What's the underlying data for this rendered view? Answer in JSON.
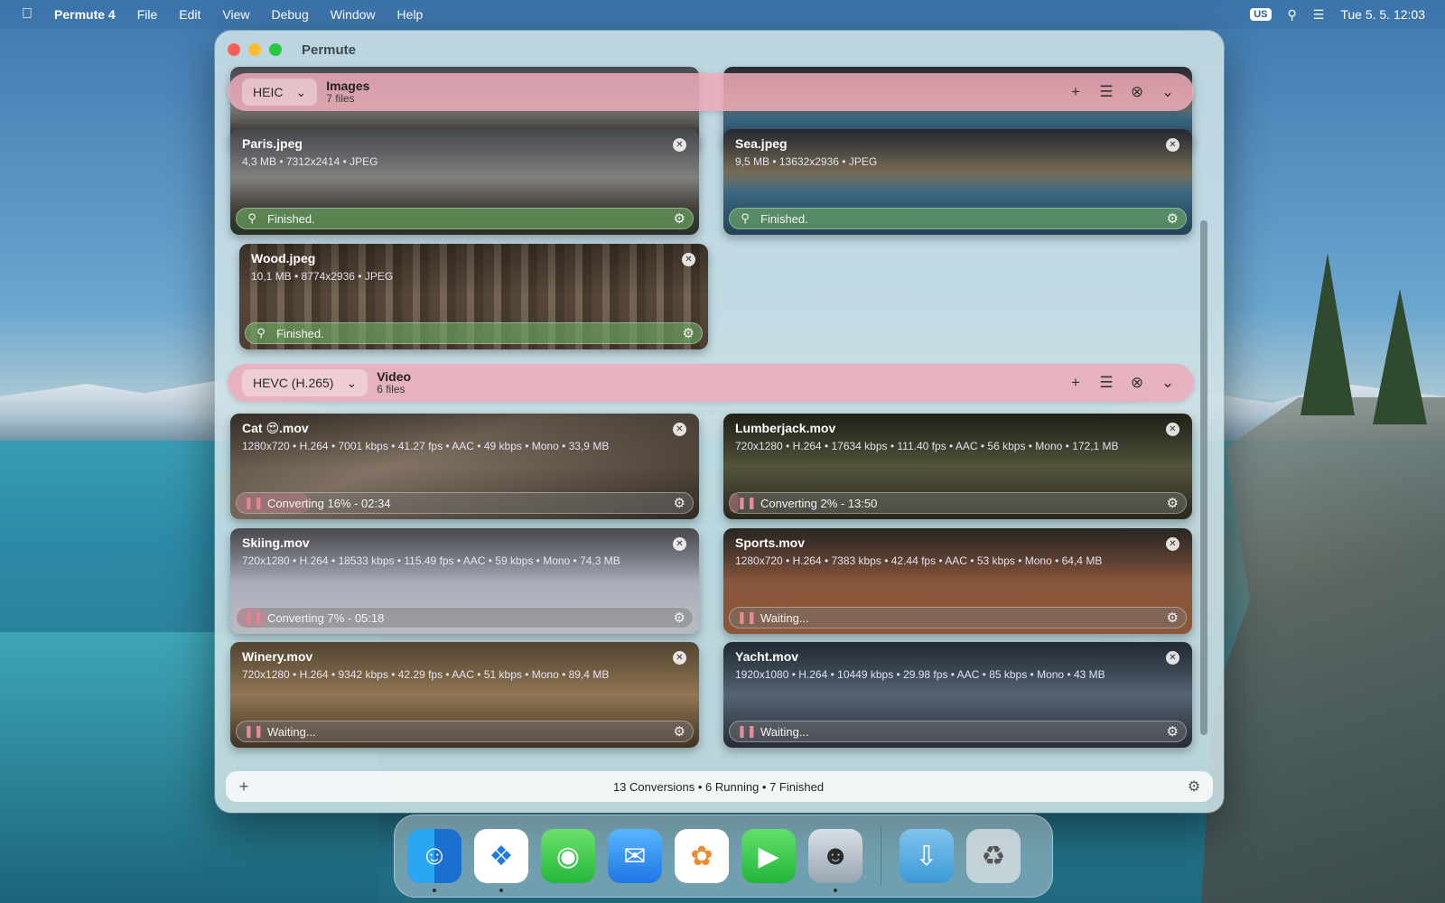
{
  "menubar": {
    "apple_icon": "apple-icon",
    "app_name": "Permute 4",
    "menus": [
      "File",
      "Edit",
      "View",
      "Debug",
      "Window",
      "Help"
    ],
    "input_source": "US",
    "datetime": "Tue 5. 5.  12:03"
  },
  "window": {
    "title": "Permute"
  },
  "groups": [
    {
      "format": "HEIC",
      "name": "Images",
      "count": "7 files"
    },
    {
      "format": "HEVC (H.265)",
      "name": "Video",
      "count": "6 files"
    }
  ],
  "image_files": [
    {
      "name": "Paris.jpeg",
      "meta": "4,3 MB • 7312x2414 • JPEG",
      "status": "Finished."
    },
    {
      "name": "Sea.jpeg",
      "meta": "9,5 MB • 13632x2936 • JPEG",
      "status": "Finished."
    },
    {
      "name": "Wood.jpeg",
      "meta": "10,1 MB • 8774x2936 • JPEG",
      "status": "Finished."
    }
  ],
  "video_files": [
    {
      "name": "Cat 😍.mov",
      "meta": "1280x720 • H.264 • 7001 kbps • 41.27 fps • AAC • 49 kbps • Mono • 33,9 MB",
      "status": "Converting 16% - 02:34",
      "progress": 0.16
    },
    {
      "name": "Lumberjack.mov",
      "meta": "720x1280 • H.264 • 17634 kbps • 111.40 fps • AAC • 56 kbps • Mono • 172,1 MB",
      "status": "Converting 2% - 13:50",
      "progress": 0.02
    },
    {
      "name": "Skiing.mov",
      "meta": "720x1280 • H.264 • 18533 kbps • 115.49 fps • AAC • 59 kbps • Mono • 74,3 MB",
      "status": "Converting 7% - 05:18",
      "progress": 0.07
    },
    {
      "name": "Sports.mov",
      "meta": "1280x720 • H.264 • 7383 kbps • 42.44 fps • AAC • 53 kbps • Mono • 64,4 MB",
      "status": "Waiting...",
      "progress": 0
    },
    {
      "name": "Winery.mov",
      "meta": "720x1280 • H.264 • 9342 kbps • 42.29 fps • AAC • 51 kbps • Mono • 89,4 MB",
      "status": "Waiting...",
      "progress": 0
    },
    {
      "name": "Yacht.mov",
      "meta": "1920x1080 • H.264 • 10449 kbps • 29.98 fps • AAC • 85 kbps • Mono • 43 MB",
      "status": "Waiting...",
      "progress": 0
    }
  ],
  "footer": {
    "summary": "13 Conversions • 6 Running • 7 Finished"
  },
  "dock": {
    "apps": [
      "finder-icon",
      "safari-icon",
      "messages-icon",
      "mail-icon",
      "photos-icon",
      "facetime-icon",
      "permute-icon",
      "downloads-icon",
      "trash-icon"
    ]
  }
}
